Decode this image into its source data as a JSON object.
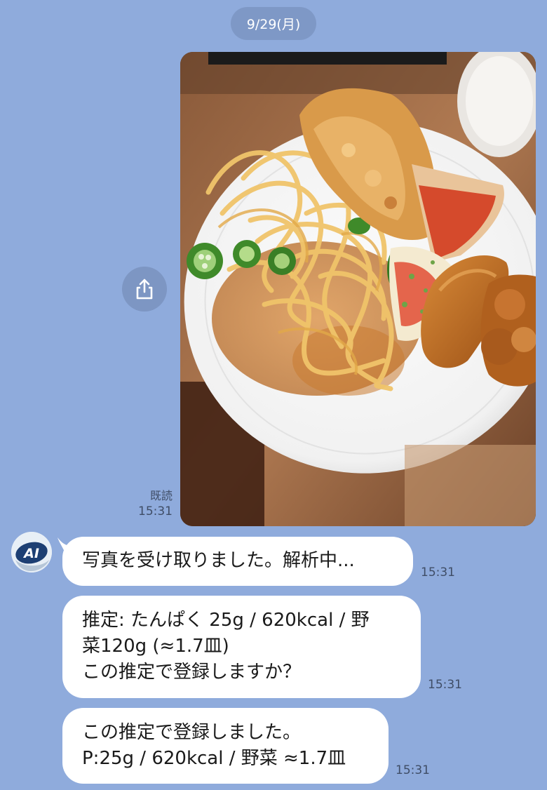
{
  "chat": {
    "date_label": "9/29(月)",
    "sent_photo": {
      "read_label": "既読",
      "time": "15:31"
    },
    "bot": {
      "avatar_text": "AI"
    },
    "messages": [
      {
        "lines": [
          "写真を受け取りました。解析中..."
        ],
        "time": "15:31"
      },
      {
        "lines": [
          "推定: たんぱく 25g / 620kcal / 野",
          "菜120g (≈1.7皿)",
          "この推定で登録しますか？"
        ],
        "time": "15:31"
      },
      {
        "lines": [
          "この推定で登録しました。",
          "P:25g / 620kcal / 野菜 ≈1.7皿"
        ],
        "time": "15:31"
      }
    ]
  },
  "colors": {
    "background": "#8fabdc",
    "bubble": "#ffffff",
    "pill": "#7e98c6"
  },
  "icons": {
    "share": "share-icon",
    "avatar": "ai-bot-avatar"
  }
}
